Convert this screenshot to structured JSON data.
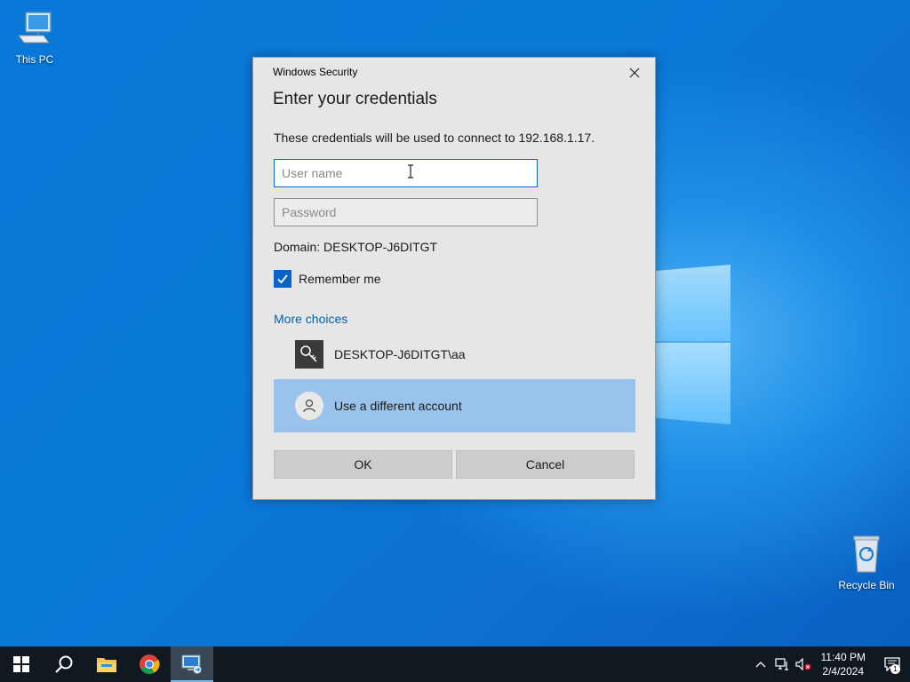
{
  "desktop": {
    "icons": [
      {
        "label": "This PC",
        "icon": "computer-icon"
      },
      {
        "label": "Recycle Bin",
        "icon": "recycle-bin-icon"
      }
    ]
  },
  "dialog": {
    "caption": "Windows Security",
    "title": "Enter your credentials",
    "message": "These credentials will be used to connect to 192.168.1.17.",
    "username": {
      "value": "",
      "placeholder": "User name"
    },
    "password": {
      "value": "",
      "placeholder": "Password"
    },
    "domain": "Domain: DESKTOP-J6DITGT",
    "remember": {
      "label": "Remember me",
      "checked": true
    },
    "more_choices": "More choices",
    "accounts": [
      {
        "label": "DESKTOP-J6DITGT\\aa",
        "icon": "key-icon"
      },
      {
        "label": "Use a different account",
        "icon": "user-icon",
        "selected": true
      }
    ],
    "ok_label": "OK",
    "cancel_label": "Cancel"
  },
  "taskbar": {
    "apps": [
      "start-icon",
      "search-icon",
      "file-explorer-icon",
      "chrome-icon",
      "remote-desktop-icon"
    ],
    "active_app": "remote-desktop-icon",
    "clock": {
      "time": "11:40 PM",
      "date": "2/4/2024"
    },
    "notification_count": "1"
  },
  "colors": {
    "accent": "#0a64c8",
    "link": "#0063b1",
    "selected_account": "#99c3ea",
    "taskbar": "#101820"
  }
}
